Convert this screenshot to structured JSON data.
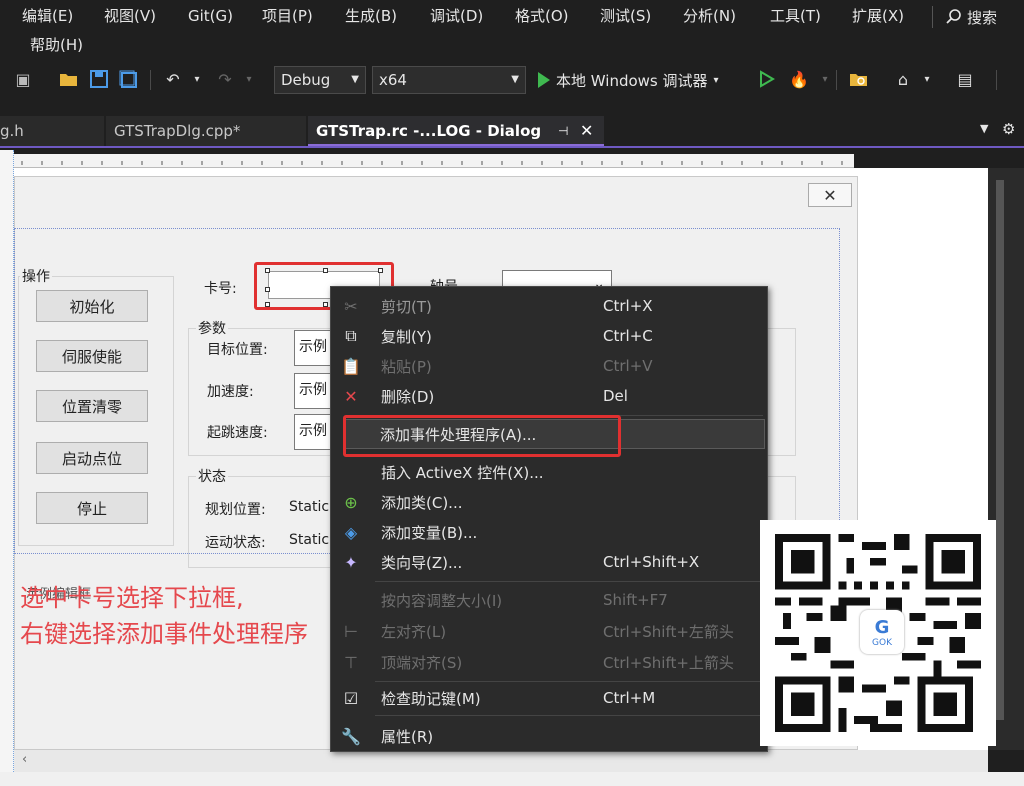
{
  "menubar": {
    "items": [
      "编辑(E)",
      "视图(V)",
      "Git(G)",
      "项目(P)",
      "生成(B)",
      "调试(D)",
      "格式(O)",
      "测试(S)",
      "分析(N)",
      "工具(T)",
      "扩展(X)"
    ],
    "help": "帮助(H)",
    "search": "搜索"
  },
  "toolbar": {
    "config": "Debug",
    "platform": "x64",
    "run_label": "本地 Windows 调试器"
  },
  "tabs": [
    {
      "label": "g.h"
    },
    {
      "label": "GTSTrapDlg.cpp*"
    },
    {
      "label": "GTSTrap.rc -...LOG - Dialog"
    }
  ],
  "dialog": {
    "group_ops": "操作",
    "buttons": [
      "初始化",
      "伺服使能",
      "位置清零",
      "启动点位",
      "停止"
    ],
    "card_label": "卡号:",
    "axis_label": "轴号",
    "group_params": "参数",
    "param_labels": [
      "目标位置:",
      "加速度:",
      "起跳速度:"
    ],
    "param_values": [
      "示例",
      "示例",
      "示例"
    ],
    "group_status": "状态",
    "status_labels": [
      "规划位置:",
      "运动状态:"
    ],
    "status_values": [
      "Static",
      "Static"
    ],
    "hidden_text": "示例编辑框"
  },
  "annotation": {
    "line1": "选中卡号选择下拉框,",
    "line2": "右键选择添加事件处理程序"
  },
  "context_menu": {
    "items": [
      {
        "label": "剪切(T)",
        "shortcut": "Ctrl+X",
        "icon": "scissors-icon",
        "enabled": false
      },
      {
        "label": "复制(Y)",
        "shortcut": "Ctrl+C",
        "icon": "copy-icon",
        "enabled": true
      },
      {
        "label": "粘贴(P)",
        "shortcut": "Ctrl+V",
        "icon": "paste-icon",
        "enabled": false
      },
      {
        "label": "删除(D)",
        "shortcut": "Del",
        "icon": "delete-icon",
        "enabled": true
      },
      {
        "label": "添加事件处理程序(A)...",
        "shortcut": "",
        "icon": "",
        "enabled": true
      },
      {
        "label": "插入 ActiveX 控件(X)...",
        "shortcut": "",
        "icon": "",
        "enabled": true
      },
      {
        "label": "添加类(C)...",
        "shortcut": "",
        "icon": "add-class-icon",
        "enabled": true
      },
      {
        "label": "添加变量(B)...",
        "shortcut": "",
        "icon": "add-variable-icon",
        "enabled": true
      },
      {
        "label": "类向导(Z)...",
        "shortcut": "Ctrl+Shift+X",
        "icon": "class-wizard-icon",
        "enabled": true
      },
      {
        "label": "按内容调整大小(I)",
        "shortcut": "Shift+F7",
        "icon": "",
        "enabled": false
      },
      {
        "label": "左对齐(L)",
        "shortcut": "Ctrl+Shift+左箭头",
        "icon": "align-left-icon",
        "enabled": false
      },
      {
        "label": "顶端对齐(S)",
        "shortcut": "Ctrl+Shift+上箭头",
        "icon": "align-top-icon",
        "enabled": false
      },
      {
        "label": "检查助记键(M)",
        "shortcut": "Ctrl+M",
        "icon": "check-mnemonic-icon",
        "enabled": true
      },
      {
        "label": "属性(R)",
        "shortcut": "",
        "icon": "wrench-icon",
        "enabled": true
      }
    ]
  },
  "qr": {
    "logo_text": "GOK"
  },
  "colors": {
    "annotation_red": "#e5484d",
    "highlight_red": "#e03030",
    "run_green": "#3fb950",
    "tab_accent": "#6e59c2"
  }
}
